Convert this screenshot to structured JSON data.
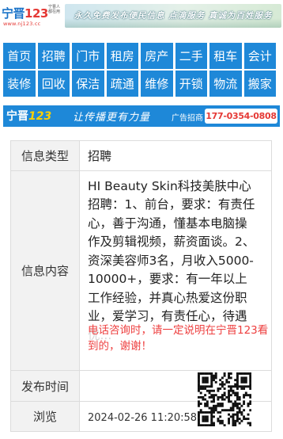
{
  "header": {
    "logo_text": "宁晋",
    "logo_num": "123",
    "logo_side": "宁晋人 都在用",
    "logo_url": "www.nj123.cc",
    "slogan": "永久免费发布便民信息  点滴服务  真诚为百姓服务"
  },
  "nav": {
    "row1": [
      "首页",
      "招聘",
      "门市",
      "租房",
      "房产",
      "二手",
      "租车",
      "会计"
    ],
    "row2": [
      "装修",
      "回收",
      "保洁",
      "疏通",
      "维修",
      "开锁",
      "物流",
      "搬家"
    ]
  },
  "ad": {
    "brand": "宁晋",
    "brand_num": "123",
    "slogan": "让传播更有力量",
    "label": "广告招商",
    "phone": "177-0354-0808"
  },
  "info": {
    "type_label": "信息类型",
    "type_value": "招聘",
    "content_label": "信息内容",
    "content_value": "HI Beauty Skin科技美肤中心招聘：1、前台，要求：有责任心，善于沟通，懂基本电脑操作及剪辑视频，薪资面谈。2、资深美容师3名，月收入5000-10000+，要求：有一年以上工作经验，并真心热爱这份职业，爱学习，有责任心，待遇优...",
    "notice": "电话咨询时，请一定说明在宁晋123看到的，谢谢！",
    "pub_label": "发布时间",
    "pub_value": "",
    "view_label": "浏览",
    "view_value": "2024-02-26 11:20:58"
  },
  "colors": {
    "nav_blue": "#1e88d8",
    "notice_red": "#ee4040",
    "phone_red": "#e53935"
  }
}
